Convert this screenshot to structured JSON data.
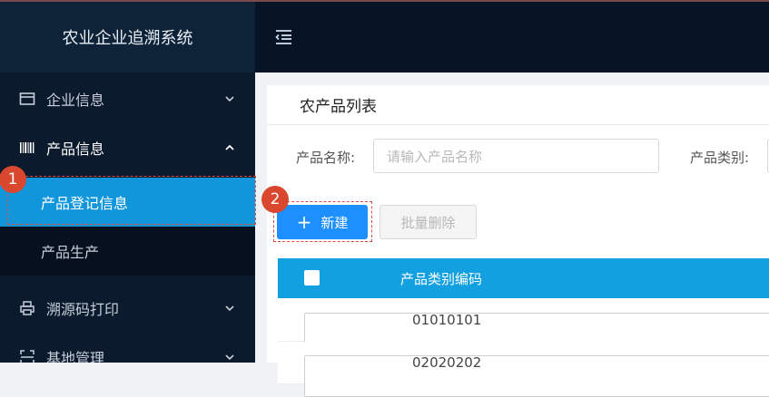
{
  "app": {
    "title": "农业企业追溯系统"
  },
  "sidebar": {
    "items": [
      {
        "label": "企业信息",
        "icon": "card-icon",
        "expanded": false
      },
      {
        "label": "产品信息",
        "icon": "barcode-icon",
        "expanded": true,
        "children": [
          {
            "label": "产品登记信息",
            "active": true
          },
          {
            "label": "产品生产",
            "active": false
          }
        ]
      },
      {
        "label": "溯源码打印",
        "icon": "printer-icon",
        "expanded": false
      },
      {
        "label": "基地管理",
        "icon": "scan-icon",
        "expanded": false
      }
    ]
  },
  "header": {
    "menu_icon": "menu-fold-icon"
  },
  "main": {
    "title": "农产品列表",
    "filters": {
      "name_label": "产品名称:",
      "name_placeholder": "请输入产品名称",
      "category_label": "产品类别:"
    },
    "actions": {
      "new_label": "新建",
      "batch_delete_label": "批量删除"
    },
    "table": {
      "columns": [
        "产品类别编码"
      ],
      "rows": [
        [
          "01010101"
        ],
        [
          "02020202"
        ]
      ]
    }
  },
  "annotations": {
    "step1": "1",
    "step2": "2"
  },
  "colors": {
    "sidebar_bg": "#0b1a2c",
    "active_blue": "#1296db",
    "primary": "#1e8fff",
    "table_header": "#12a0e0",
    "badge": "#d9472f"
  }
}
